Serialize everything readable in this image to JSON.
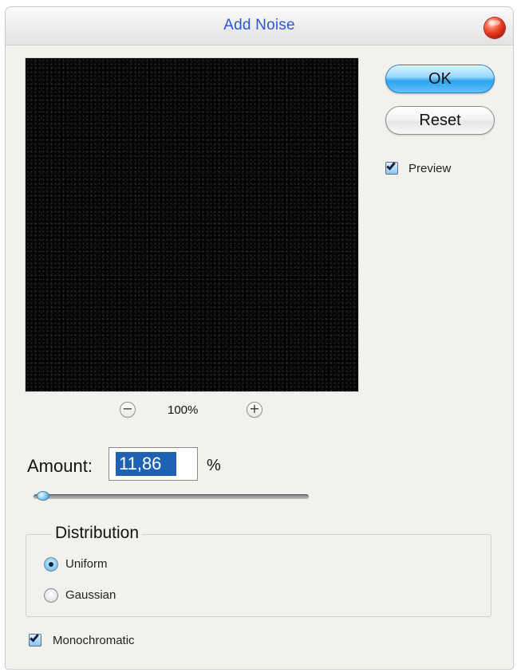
{
  "dialog": {
    "title": "Add Noise"
  },
  "preview": {
    "zoom_level": "100%"
  },
  "buttons": {
    "ok_label": "OK",
    "reset_label": "Reset"
  },
  "options": {
    "preview_label": "Preview",
    "preview_checked": true,
    "monochromatic_label": "Monochromatic",
    "monochromatic_checked": true
  },
  "amount": {
    "label": "Amount:",
    "value": "11,86",
    "unit": "%",
    "slider_value": 11.86
  },
  "distribution": {
    "title": "Distribution",
    "uniform_label": "Uniform",
    "gaussian_label": "Gaussian",
    "selected": "Uniform"
  },
  "icons": {
    "close": "close-icon",
    "zoom_out": "minus-icon",
    "zoom_in": "plus-icon",
    "checkmark": "checkmark-icon"
  },
  "colors": {
    "title": "#2b56d8",
    "ok_button": "#2aa4ed",
    "selected_input_text": "#1f61b2",
    "close_button": "#e53d22"
  }
}
